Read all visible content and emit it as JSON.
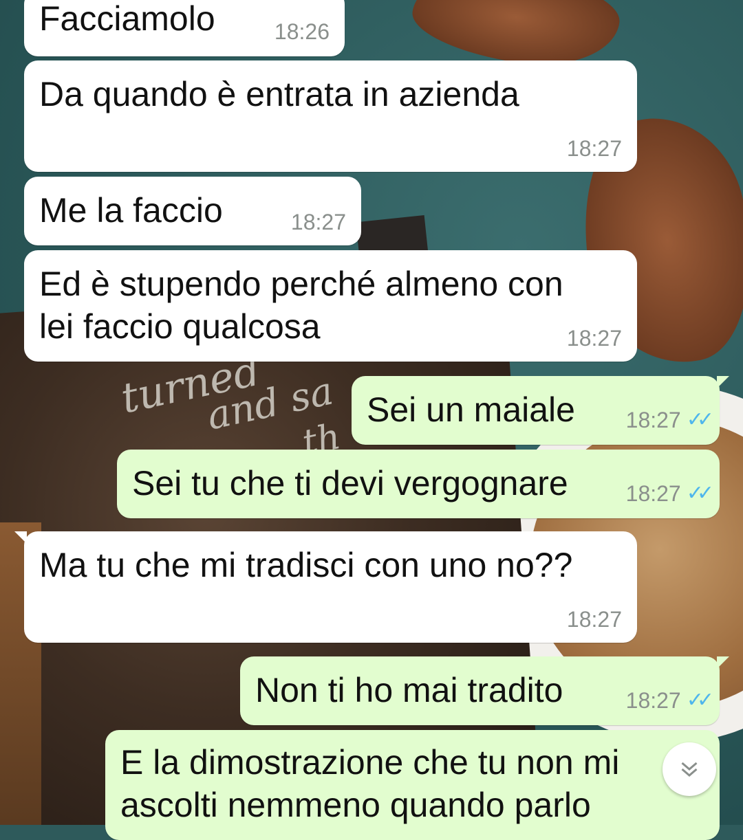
{
  "colors": {
    "incoming_bubble": "#ffffff",
    "outgoing_bubble": "#e2fdcf",
    "read_ticks": "#4fb6ec",
    "timestamp": "#8a8f8c"
  },
  "wallpaper": {
    "chalk_text_1": "turned",
    "chalk_text_2": "and sa",
    "chalk_text_3": "th"
  },
  "messages": [
    {
      "direction": "in",
      "text": "Facciamolo",
      "time": "18:26"
    },
    {
      "direction": "in",
      "text": "Da quando è entrata in azienda",
      "time": "18:27"
    },
    {
      "direction": "in",
      "text": "Me la faccio",
      "time": "18:27"
    },
    {
      "direction": "in",
      "text": "Ed è stupendo perché almeno con lei faccio qualcosa",
      "time": "18:27"
    },
    {
      "direction": "out",
      "text": "Sei un maiale",
      "time": "18:27",
      "status": "read"
    },
    {
      "direction": "out",
      "text": "Sei tu che ti devi vergognare",
      "time": "18:27",
      "status": "read"
    },
    {
      "direction": "in",
      "text": "Ma tu che mi tradisci con uno no??",
      "time": "18:27"
    },
    {
      "direction": "out",
      "text": "Non ti ho mai tradito",
      "time": "18:27",
      "status": "read"
    },
    {
      "direction": "out",
      "text": "E la dimostrazione che tu non mi ascolti nemmeno quando parlo",
      "time": ""
    }
  ],
  "scroll_to_bottom": {
    "icon": "double-chevron-down-icon"
  }
}
